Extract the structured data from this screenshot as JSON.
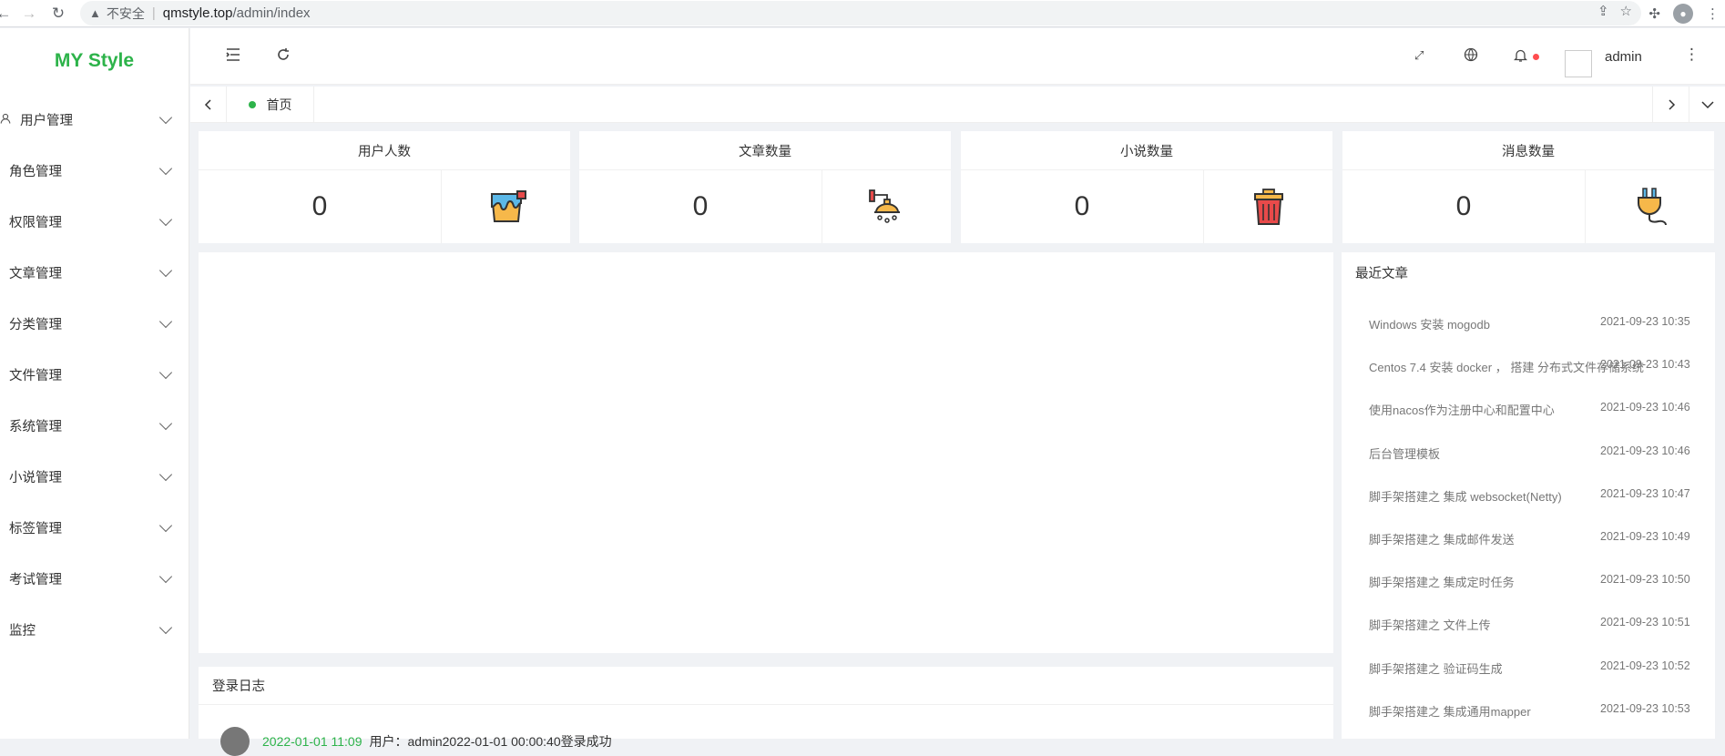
{
  "browser": {
    "insecure_label": "不安全",
    "url_host": "qmstyle.top",
    "url_path": "/admin/index"
  },
  "app": {
    "logo": "MY Style",
    "user_name": "admin"
  },
  "sidebar": {
    "items": [
      {
        "label": "用户管理"
      },
      {
        "label": "角色管理"
      },
      {
        "label": "权限管理"
      },
      {
        "label": "文章管理"
      },
      {
        "label": "分类管理"
      },
      {
        "label": "文件管理"
      },
      {
        "label": "系统管理"
      },
      {
        "label": "小说管理"
      },
      {
        "label": "标签管理"
      },
      {
        "label": "考试管理"
      },
      {
        "label": "监控"
      }
    ]
  },
  "tabs": {
    "home_label": "首页"
  },
  "stats": [
    {
      "title": "用户人数",
      "value": "0",
      "icon": "paint-bucket-icon"
    },
    {
      "title": "文章数量",
      "value": "0",
      "icon": "shower-icon"
    },
    {
      "title": "小说数量",
      "value": "0",
      "icon": "trash-can-icon"
    },
    {
      "title": "消息数量",
      "value": "0",
      "icon": "plug-icon"
    }
  ],
  "recent_articles": {
    "title": "最近文章",
    "items": [
      {
        "title": "Windows 安装 mogodb",
        "date": "2021-09-23 10:35"
      },
      {
        "title": "Centos 7.4 安装 docker ， 搭建 分布式文件存储系统",
        "date": "2021-09-23 10:43"
      },
      {
        "title": "使用nacos作为注册中心和配置中心",
        "date": "2021-09-23 10:46"
      },
      {
        "title": "后台管理模板",
        "date": "2021-09-23 10:46"
      },
      {
        "title": "脚手架搭建之 集成 websocket(Netty)",
        "date": "2021-09-23 10:47"
      },
      {
        "title": "脚手架搭建之 集成邮件发送",
        "date": "2021-09-23 10:49"
      },
      {
        "title": "脚手架搭建之 集成定时任务",
        "date": "2021-09-23 10:50"
      },
      {
        "title": "脚手架搭建之 文件上传",
        "date": "2021-09-23 10:51"
      },
      {
        "title": "脚手架搭建之 验证码生成",
        "date": "2021-09-23 10:52"
      },
      {
        "title": "脚手架搭建之 集成通用mapper",
        "date": "2021-09-23 10:53"
      }
    ]
  },
  "login_log": {
    "title": "登录日志",
    "entry_time": "2022-01-01 11:09",
    "entry_text": "用户：admin2022-01-01 00:00:40登录成功"
  },
  "colors": {
    "brand": "#2db34a",
    "notify_dot": "#ff4d4f"
  }
}
